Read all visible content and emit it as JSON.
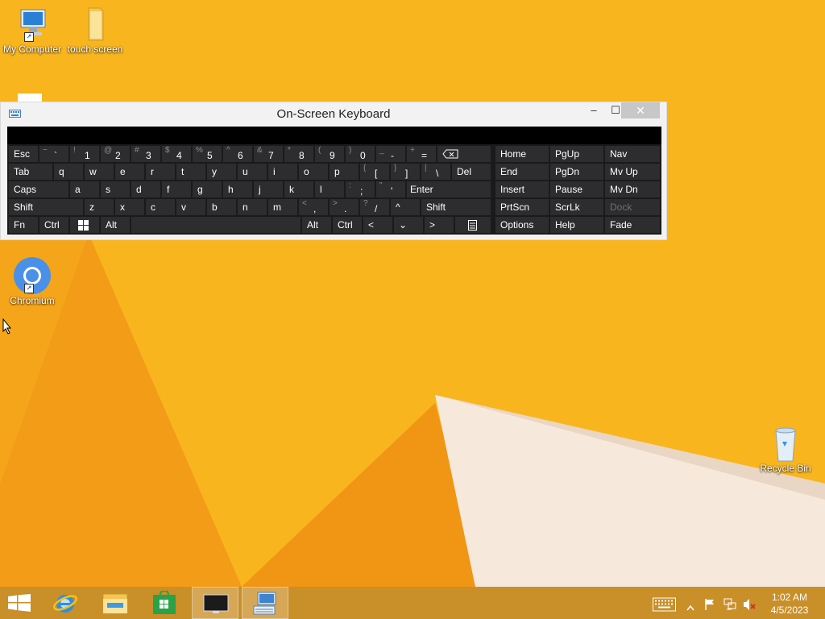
{
  "desktop": {
    "icons": [
      {
        "label": "My Computer"
      },
      {
        "label": "touch screen"
      },
      {
        "label": "Chromium"
      },
      {
        "label": "Recycle Bin"
      }
    ]
  },
  "osk": {
    "title": "On-Screen Keyboard",
    "window_buttons": {
      "minimize": "–",
      "maximize": "☐",
      "close": "✕"
    },
    "keys": {
      "esc": "Esc",
      "tab": "Tab",
      "caps": "Caps",
      "shift_l": "Shift",
      "fn": "Fn",
      "ctrl_l": "Ctrl",
      "alt_l": "Alt",
      "alt_r": "Alt",
      "ctrl_r": "Ctrl",
      "del": "Del",
      "enter": "Enter",
      "shift_r": "Shift",
      "left": "<",
      "up": "^",
      "down": "⌄",
      "right": ">",
      "home": "Home",
      "pgup": "PgUp",
      "nav": "Nav",
      "end": "End",
      "pgdn": "PgDn",
      "mvup": "Mv Up",
      "insert": "Insert",
      "pause": "Pause",
      "mvdn": "Mv Dn",
      "prtscn": "PrtScn",
      "scrlk": "ScrLk",
      "dock": "Dock",
      "options": "Options",
      "help": "Help",
      "fade": "Fade"
    },
    "number_row": [
      {
        "s": "~",
        "m": "`"
      },
      {
        "s": "!",
        "m": "1"
      },
      {
        "s": "@",
        "m": "2"
      },
      {
        "s": "#",
        "m": "3"
      },
      {
        "s": "$",
        "m": "4"
      },
      {
        "s": "%",
        "m": "5"
      },
      {
        "s": "^",
        "m": "6"
      },
      {
        "s": "&",
        "m": "7"
      },
      {
        "s": "*",
        "m": "8"
      },
      {
        "s": "(",
        "m": "9"
      },
      {
        "s": ")",
        "m": "0"
      },
      {
        "s": "_",
        "m": "-"
      },
      {
        "s": "+",
        "m": "="
      }
    ],
    "row_q": [
      "q",
      "w",
      "e",
      "r",
      "t",
      "y",
      "u",
      "i",
      "o",
      "p"
    ],
    "row_q_sym": [
      {
        "s": "{",
        "m": "["
      },
      {
        "s": "}",
        "m": "]"
      },
      {
        "s": "|",
        "m": "\\"
      }
    ],
    "row_a": [
      "a",
      "s",
      "d",
      "f",
      "g",
      "h",
      "j",
      "k",
      "l"
    ],
    "row_a_sym": [
      {
        "s": ":",
        "m": ";"
      },
      {
        "s": "\"",
        "m": "'"
      }
    ],
    "row_z": [
      "z",
      "x",
      "c",
      "v",
      "b",
      "n",
      "m"
    ],
    "row_z_sym": [
      {
        "s": "<",
        "m": ","
      },
      {
        "s": ">",
        "m": "."
      },
      {
        "s": "?",
        "m": "/"
      }
    ]
  },
  "taskbar": {
    "clock_time": "1:02 AM",
    "clock_date": "4/5/2023"
  }
}
